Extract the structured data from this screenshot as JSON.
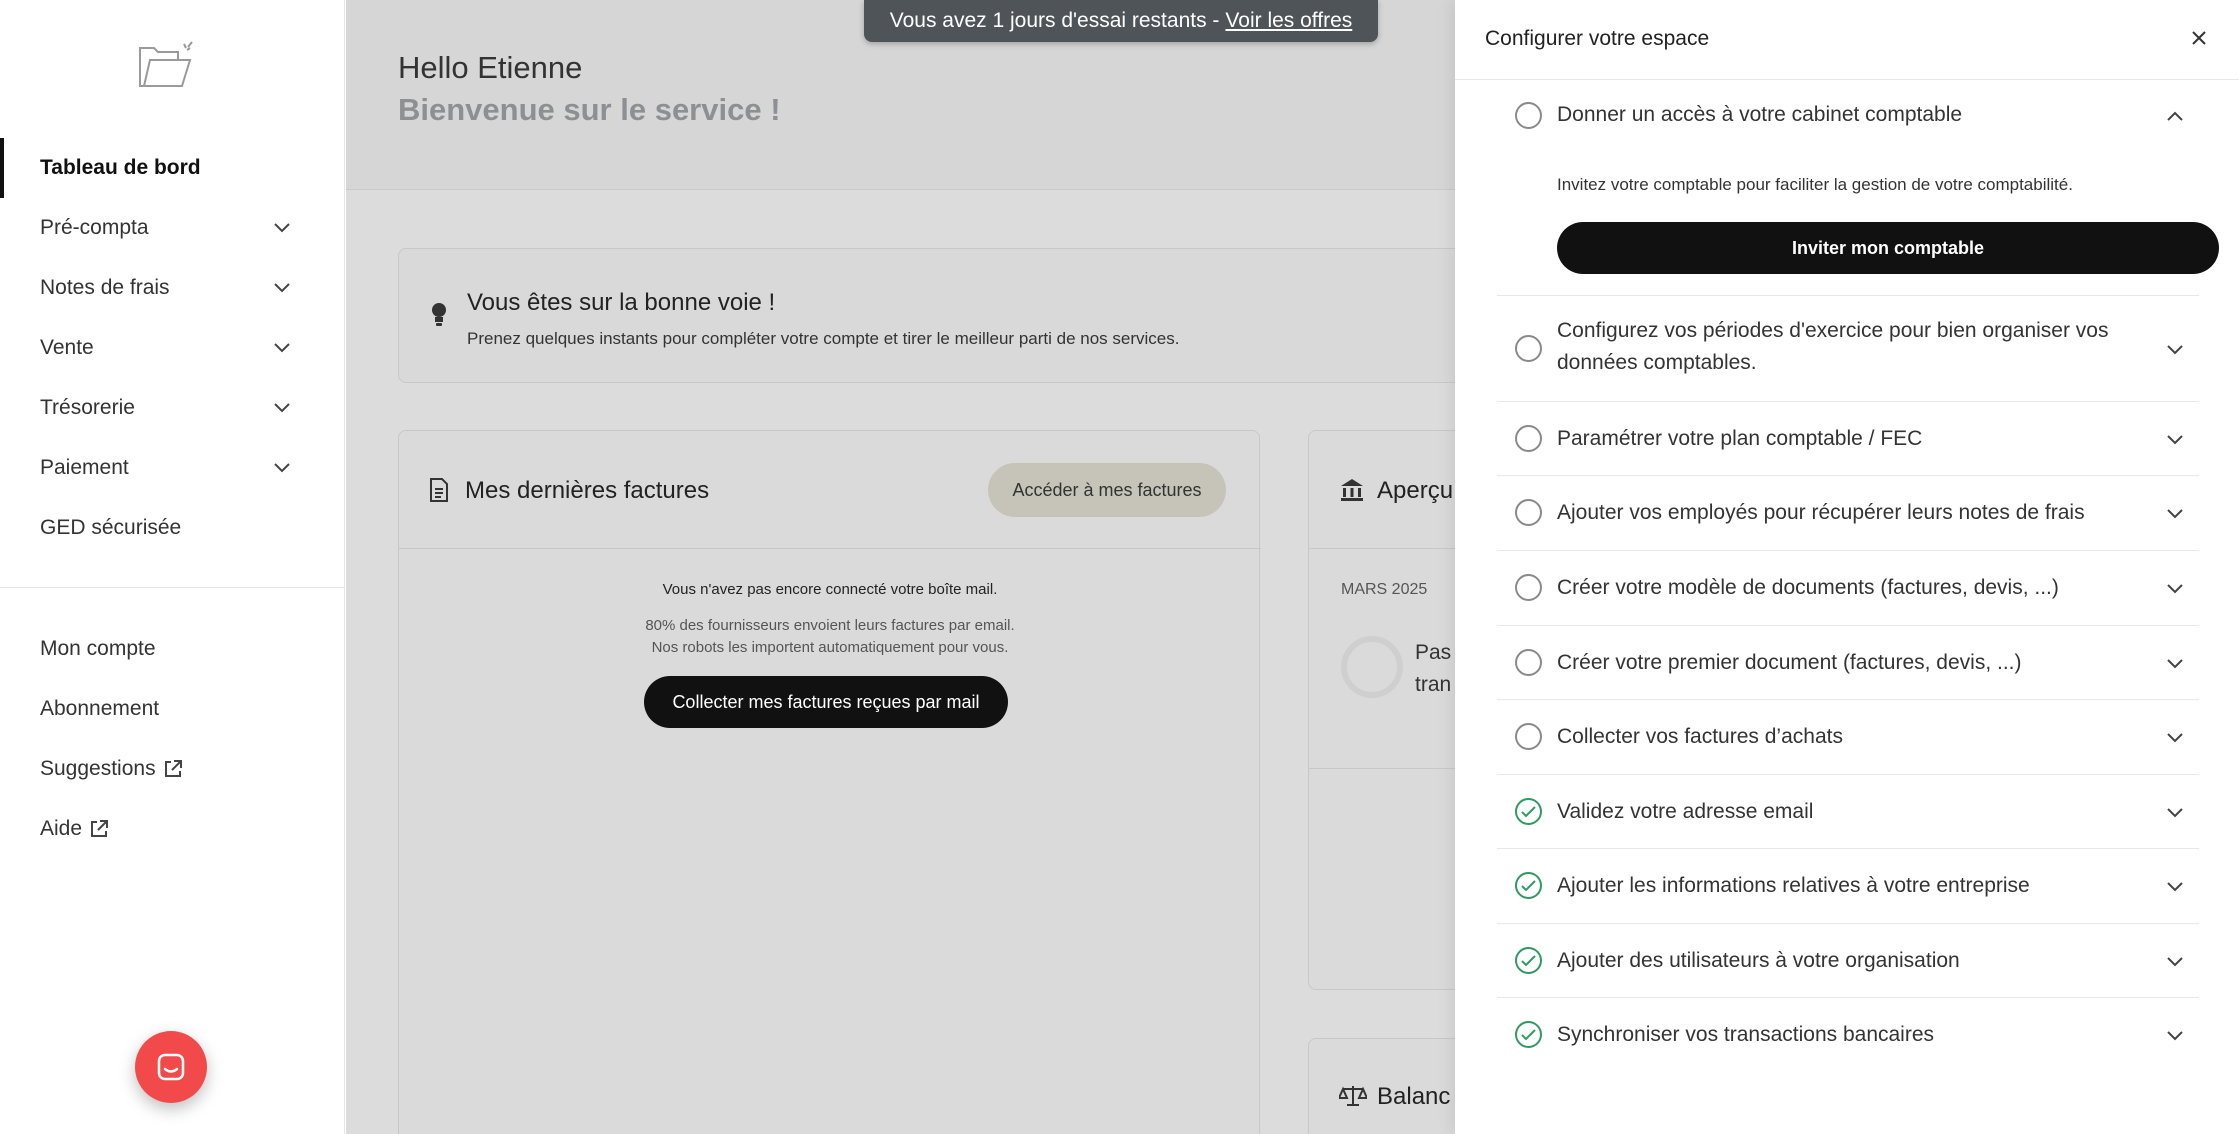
{
  "sidebar": {
    "logo_icon": "folder-logo-icon",
    "nav": [
      {
        "label": "Tableau de bord",
        "active": true,
        "chevron": false
      },
      {
        "label": "Pré-compta",
        "active": false,
        "chevron": true
      },
      {
        "label": "Notes de frais",
        "active": false,
        "chevron": true
      },
      {
        "label": "Vente",
        "active": false,
        "chevron": true
      },
      {
        "label": "Trésorerie",
        "active": false,
        "chevron": true
      },
      {
        "label": "Paiement",
        "active": false,
        "chevron": true
      },
      {
        "label": "GED sécurisée",
        "active": false,
        "chevron": false
      }
    ],
    "nav2": [
      {
        "label": "Mon compte",
        "external": false
      },
      {
        "label": "Abonnement",
        "external": false
      },
      {
        "label": "Suggestions",
        "external": true
      },
      {
        "label": "Aide",
        "external": true
      }
    ],
    "chat_icon": "chat-icon",
    "chat_color": "#f24a4a"
  },
  "banner": {
    "text": "Vous avez 1 jours d'essai restants -",
    "link": "Voir les offres"
  },
  "header": {
    "hello": "Hello Etienne",
    "welcome": "Bienvenue sur le service !"
  },
  "tip": {
    "icon": "lightbulb-icon",
    "title": "Vous êtes sur la bonne voie !",
    "subtitle": "Prenez quelques instants pour compléter votre compte et tirer le meilleur parti de nos services."
  },
  "invoices": {
    "icon": "document-icon",
    "title": "Mes dernières factures",
    "button": "Accéder à mes factures",
    "empty_title": "Vous n'avez pas encore connecté votre boîte mail.",
    "empty_line1": "80% des fournisseurs envoient leurs factures par email.",
    "empty_line2": "Nos robots les importent automatiquement pour vous.",
    "collect_button": "Collecter mes factures reçues par mail"
  },
  "overview": {
    "icon": "bank-icon",
    "title": "Aperçu",
    "month": "MARS 2025",
    "text1": "Pas",
    "text2": "tran"
  },
  "balance": {
    "icon": "scale-icon",
    "title": "Balanc"
  },
  "panel": {
    "title": "Configurer votre espace",
    "tasks": [
      {
        "label": "Donner un accès à votre cabinet comptable",
        "done": false,
        "expanded": true,
        "description": "Invitez votre comptable pour faciliter la gestion de votre comptabilité.",
        "button": "Inviter mon comptable"
      },
      {
        "label": "Configurez vos périodes d'exercice pour bien organiser vos",
        "label2": "données comptables.",
        "done": false
      },
      {
        "label": "Paramétrer votre plan comptable / FEC",
        "done": false
      },
      {
        "label": "Ajouter vos employés pour récupérer leurs notes de frais",
        "done": false
      },
      {
        "label": "Créer votre modèle de documents (factures, devis, ...)",
        "done": false
      },
      {
        "label": "Créer votre premier document (factures, devis, ...)",
        "done": false
      },
      {
        "label": "Collecter vos factures d’achats",
        "done": false
      },
      {
        "label": "Validez votre adresse email",
        "done": true
      },
      {
        "label": "Ajouter les informations relatives à votre entreprise",
        "done": true
      },
      {
        "label": "Ajouter des utilisateurs à votre organisation",
        "done": true
      },
      {
        "label": "Synchroniser vos transactions bancaires",
        "done": true
      }
    ],
    "done_color": "#2f9a63"
  }
}
